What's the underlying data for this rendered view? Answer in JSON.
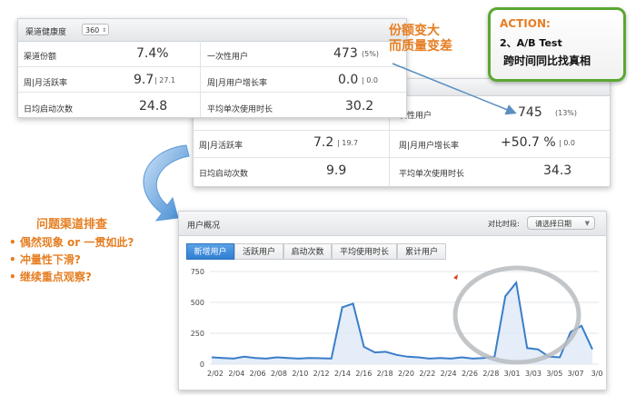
{
  "back_panel": {
    "row1_label": "次性用户",
    "row1_value": "745",
    "row1_pct": "(13%)",
    "row2_label_left": "周|月活跃率",
    "row2_value_left": "7.2",
    "row2_sub_left": "| 19.7",
    "row2_label_right": "周|月用户增长率",
    "row2_value_right": "+50.7 %",
    "row2_sub_right": "| 0.0",
    "row3_label_left": "日均启动次数",
    "row3_value_left": "9.9",
    "row3_label_right": "平均单次使用时长",
    "row3_value_right": "34.3"
  },
  "front_panel": {
    "title": "渠道健康度",
    "select_value": "360",
    "rows": [
      {
        "label_left": "渠道份额",
        "value_left": "7.4%",
        "label_right": "一次性用户",
        "value_right": "473",
        "sub_right": "(5%)"
      },
      {
        "label_left": "周|月活跃率",
        "value_left": "9.7",
        "sub_left": "| 27.1",
        "label_right": "周|月用户增长率",
        "value_right": "0.0",
        "sub_right": "| 0.0"
      },
      {
        "label_left": "日均启动次数",
        "value_left": "24.8",
        "label_right": "平均单次使用时长",
        "value_right": "30.2"
      }
    ]
  },
  "annotations": {
    "top_note_line1": "份额变大",
    "top_note_line2": "而质量变差",
    "action_title": "ACTION:",
    "action_line1": "2、A/B Test",
    "action_line2": "跨时间同比找真相",
    "left_title": "问题渠道排查",
    "bullets": [
      "偶然现象 or 一贯如此?",
      "冲量性下滑?",
      "继续重点观察?"
    ]
  },
  "chart_panel": {
    "title": "用户概况",
    "period_label": "对比时段:",
    "period_select": "请选择日期",
    "tabs": [
      "新增用户",
      "活跃用户",
      "启动次数",
      "平均使用时长",
      "累计用户"
    ],
    "colors": {
      "line": "#3a7dc9",
      "fill": "#dde9f6",
      "accent": "#e67e22",
      "action_border": "#5aa832"
    }
  },
  "chart_data": {
    "type": "line",
    "title": "",
    "xlabel": "",
    "ylabel": "",
    "ylim": [
      0,
      750
    ],
    "yticks": [
      0,
      250,
      500,
      750
    ],
    "grid": true,
    "x_tick_labels": [
      "2/02",
      "2/04",
      "2/06",
      "2/08",
      "2/10",
      "2/12",
      "2/14",
      "2/16",
      "2/18",
      "2/20",
      "2/22",
      "2/24",
      "2/26",
      "2/28",
      "3/01",
      "3/03",
      "3/05",
      "3/07",
      "3/0"
    ],
    "series": [
      {
        "values": [
          55,
          50,
          45,
          60,
          50,
          45,
          55,
          50,
          45,
          50,
          48,
          45,
          460,
          490,
          140,
          95,
          100,
          75,
          60,
          55,
          45,
          50,
          45,
          55,
          45,
          50,
          60,
          550,
          660,
          130,
          120,
          60,
          55,
          260,
          310,
          120
        ]
      }
    ]
  }
}
